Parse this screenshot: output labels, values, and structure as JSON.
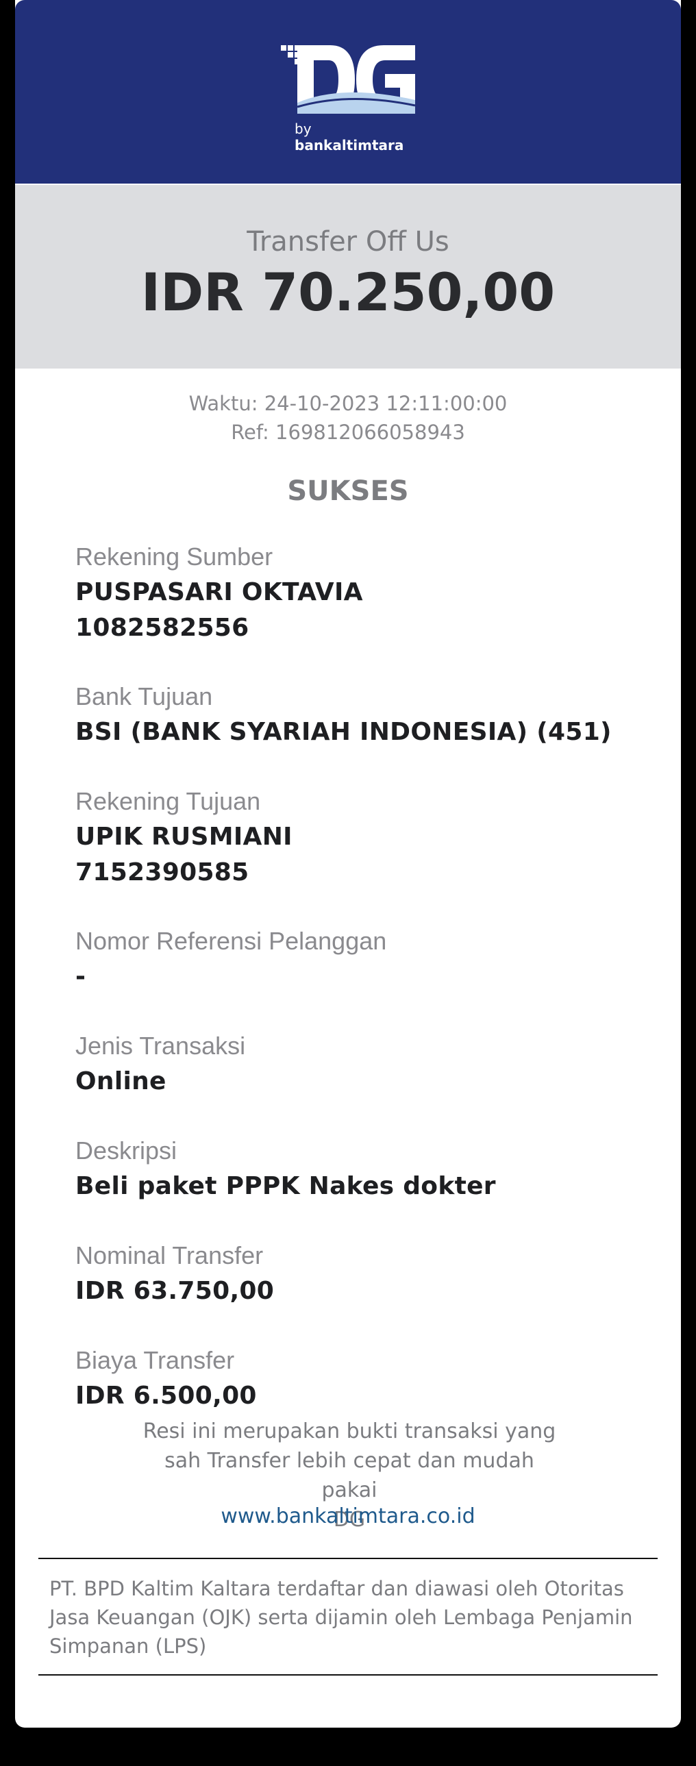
{
  "brand": {
    "logo_by": "by",
    "logo_bank": "bankaltimtara",
    "colors": {
      "header": "#22307a",
      "band": "#dcdde0",
      "link": "#1f5a8c"
    }
  },
  "transaction": {
    "type": "Transfer Off Us",
    "amount": "IDR 70.250,00",
    "time": "Waktu: 24-10-2023 12:11:00:00",
    "ref": "Ref: 169812066058943",
    "status": "SUKSES"
  },
  "fields": {
    "source_label": "Rekening Sumber",
    "source_name": "PUSPASARI OKTAVIA",
    "source_account": "1082582556",
    "bank_label": "Bank Tujuan",
    "bank_value": "BSI (BANK SYARIAH INDONESIA) (451)",
    "dest_label": "Rekening Tujuan",
    "dest_name": "UPIK RUSMIANI",
    "dest_account": "7152390585",
    "custref_label": "Nomor Referensi Pelanggan",
    "custref_value": "-",
    "txtype_label": "Jenis Transaksi",
    "txtype_value": "Online",
    "desc_label": "Deskripsi",
    "desc_value": "Beli paket PPPK Nakes dokter",
    "nominal_label": "Nominal Transfer",
    "nominal_value": "IDR 63.750,00",
    "fee_label": "Biaya Transfer",
    "fee_value": "IDR 6.500,00"
  },
  "note": {
    "line1": "Resi ini merupakan bukti transaksi yang",
    "line2": "sah Transfer lebih cepat dan mudah pakai",
    "line3": "DG",
    "link": "www.bankaltimtara.co.id"
  },
  "footer": {
    "line1": "PT. BPD Kaltim Kaltara terdaftar dan diawasi oleh Otoritas",
    "line2": "Jasa Keuangan (OJK) serta dijamin oleh Lembaga Penjamin",
    "line3": "Simpanan (LPS)"
  }
}
